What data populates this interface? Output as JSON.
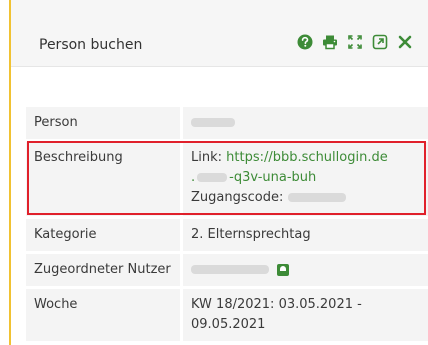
{
  "panel": {
    "title": "Person buchen"
  },
  "toolbar": {
    "icons": [
      "help-icon",
      "print-icon",
      "fullscreen-icon",
      "open-external-icon",
      "close-icon"
    ],
    "accent": "#3d8b37"
  },
  "details": {
    "person": {
      "label": "Person",
      "value_redacted": true
    },
    "description": {
      "label": "Beschreibung",
      "link_prefix": "Link:",
      "link_start": "https://bbb.schullogin.de",
      "link_dot": ".",
      "link_end": "-q3v-una-buh",
      "code_label": "Zugangscode:"
    },
    "category": {
      "label": "Kategorie",
      "value": "2. Elternsprechtag"
    },
    "assigned_user": {
      "label": "Zugeordneter Nutzer",
      "value_redacted": true
    },
    "week": {
      "label": "Woche",
      "value": "KW 18/2021: 03.05.2021 - 09.05.2021"
    }
  },
  "highlight_color": "#e0202b"
}
